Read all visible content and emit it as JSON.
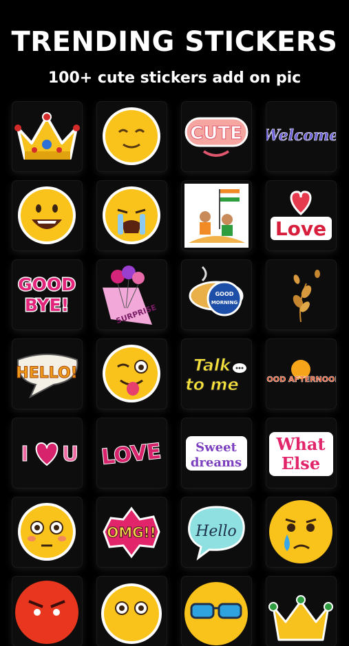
{
  "header": {
    "title": "TRENDING STICKERS",
    "subtitle": "100+ cute stickers add on pic"
  },
  "stickers": [
    {
      "icon": "crown-icon"
    },
    {
      "icon": "smiling-emoji-icon"
    },
    {
      "icon": "cute-text-icon",
      "text": "CUTE"
    },
    {
      "icon": "welcome-text-icon",
      "text": "Welcome"
    },
    {
      "icon": "laughing-emoji-icon"
    },
    {
      "icon": "crying-emoji-icon"
    },
    {
      "icon": "republic-day-icon"
    },
    {
      "icon": "heart-love-icon",
      "text": "Love"
    },
    {
      "icon": "good-bye-text-icon",
      "text": "GOOD BYE!"
    },
    {
      "icon": "balloons-surprise-icon",
      "text": "SURPRISE"
    },
    {
      "icon": "good-morning-teapot-icon",
      "text": "GOOD MORNING"
    },
    {
      "icon": "autumn-leaves-icon"
    },
    {
      "icon": "hello-speech-bubble-icon",
      "text": "HELLO!"
    },
    {
      "icon": "winking-tongue-emoji-icon"
    },
    {
      "icon": "talk-to-me-text-icon",
      "text": "Talk to me"
    },
    {
      "icon": "good-afternoon-text-icon",
      "text": "GOOD AFTERNOON"
    },
    {
      "icon": "i-love-u-text-icon",
      "text": "I U"
    },
    {
      "icon": "love-text-icon",
      "text": "LOVE"
    },
    {
      "icon": "sweet-dreams-text-icon",
      "text": "Sweet dreams"
    },
    {
      "icon": "what-else-text-icon",
      "text": "What Else"
    },
    {
      "icon": "flushed-emoji-icon"
    },
    {
      "icon": "omg-text-icon",
      "text": "OMG!!"
    },
    {
      "icon": "hello-bubble-icon",
      "text": "Hello"
    },
    {
      "icon": "sad-tear-emoji-icon"
    },
    {
      "icon": "angry-emoji-icon"
    },
    {
      "icon": "surprised-emoji-icon"
    },
    {
      "icon": "sunglasses-emoji-icon"
    },
    {
      "icon": "crown-outline-icon"
    }
  ]
}
